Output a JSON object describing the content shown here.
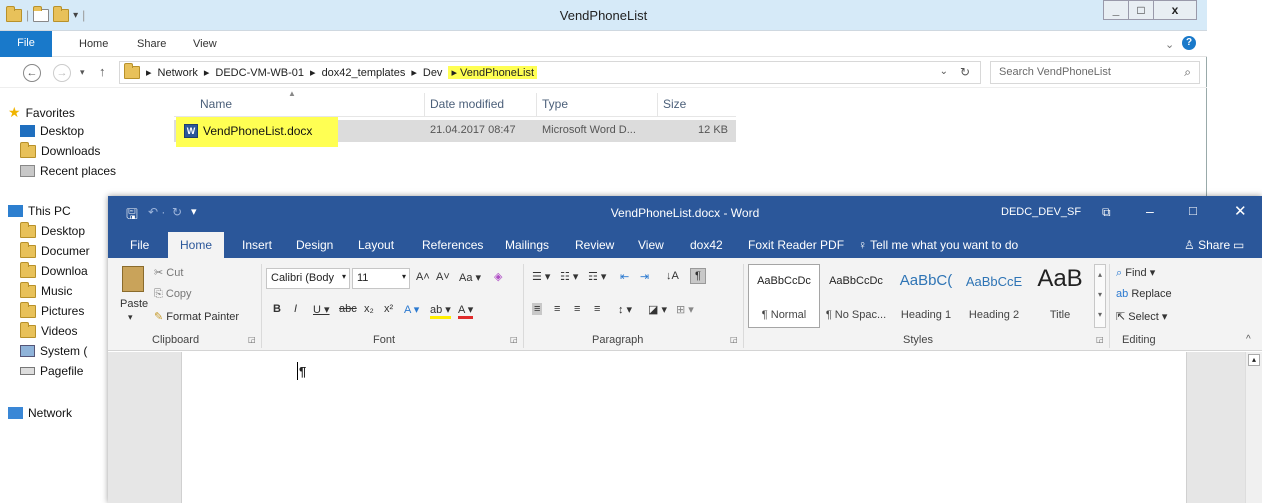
{
  "explorer": {
    "title": "VendPhoneList",
    "window_buttons": [
      "_",
      "□",
      "x"
    ],
    "ribbon_tabs": {
      "file": "File",
      "home": "Home",
      "share": "Share",
      "view": "View"
    },
    "address": {
      "parts": [
        "Network",
        "DEDC-VM-WB-01",
        "dox42_templates",
        "Dev",
        "VendPhoneList"
      ],
      "separator": "▸"
    },
    "search": {
      "placeholder": "Search VendPhoneList"
    },
    "nav": {
      "favorites": "Favorites",
      "desktop": "Desktop",
      "downloads": "Downloads",
      "recent": "Recent places",
      "thispc": "This PC",
      "pc_desktop": "Desktop",
      "documents": "Documer",
      "pc_downloads": "Downloa",
      "music": "Music",
      "pictures": "Pictures",
      "videos": "Videos",
      "system": "System (",
      "pagefile": "Pagefile",
      "network": "Network"
    },
    "columns": {
      "name": "Name",
      "date": "Date modified",
      "type": "Type",
      "size": "Size"
    },
    "file": {
      "name": "VendPhoneList.docx",
      "date": "21.04.2017 08:47",
      "type": "Microsoft Word D...",
      "size": "12 KB"
    }
  },
  "word": {
    "title": "VendPhoneList.docx - Word",
    "user": "DEDC_DEV_SF",
    "tabs": {
      "file": "File",
      "home": "Home",
      "insert": "Insert",
      "design": "Design",
      "layout": "Layout",
      "references": "References",
      "mailings": "Mailings",
      "review": "Review",
      "view": "View",
      "dox42": "dox42",
      "foxit": "Foxit Reader PDF"
    },
    "tell_me": "Tell me what you want to do",
    "share": "Share",
    "clipboard": {
      "label": "Clipboard",
      "paste": "Paste",
      "cut": "Cut",
      "copy": "Copy",
      "format_painter": "Format Painter"
    },
    "font": {
      "label": "Font",
      "name": "Calibri (Body",
      "size": "11"
    },
    "paragraph": {
      "label": "Paragraph"
    },
    "styles": {
      "label": "Styles",
      "items": [
        {
          "sample": "AaBbCcDc",
          "name": "¶ Normal"
        },
        {
          "sample": "AaBbCcDc",
          "name": "¶ No Spac..."
        },
        {
          "sample": "AaBbC(",
          "name": "Heading 1"
        },
        {
          "sample": "AaBbCcE",
          "name": "Heading 2"
        },
        {
          "sample": "AaB",
          "name": "Title"
        }
      ]
    },
    "editing": {
      "label": "Editing",
      "find": "Find",
      "replace": "Replace",
      "select": "Select"
    },
    "doc_mark": "¶"
  }
}
